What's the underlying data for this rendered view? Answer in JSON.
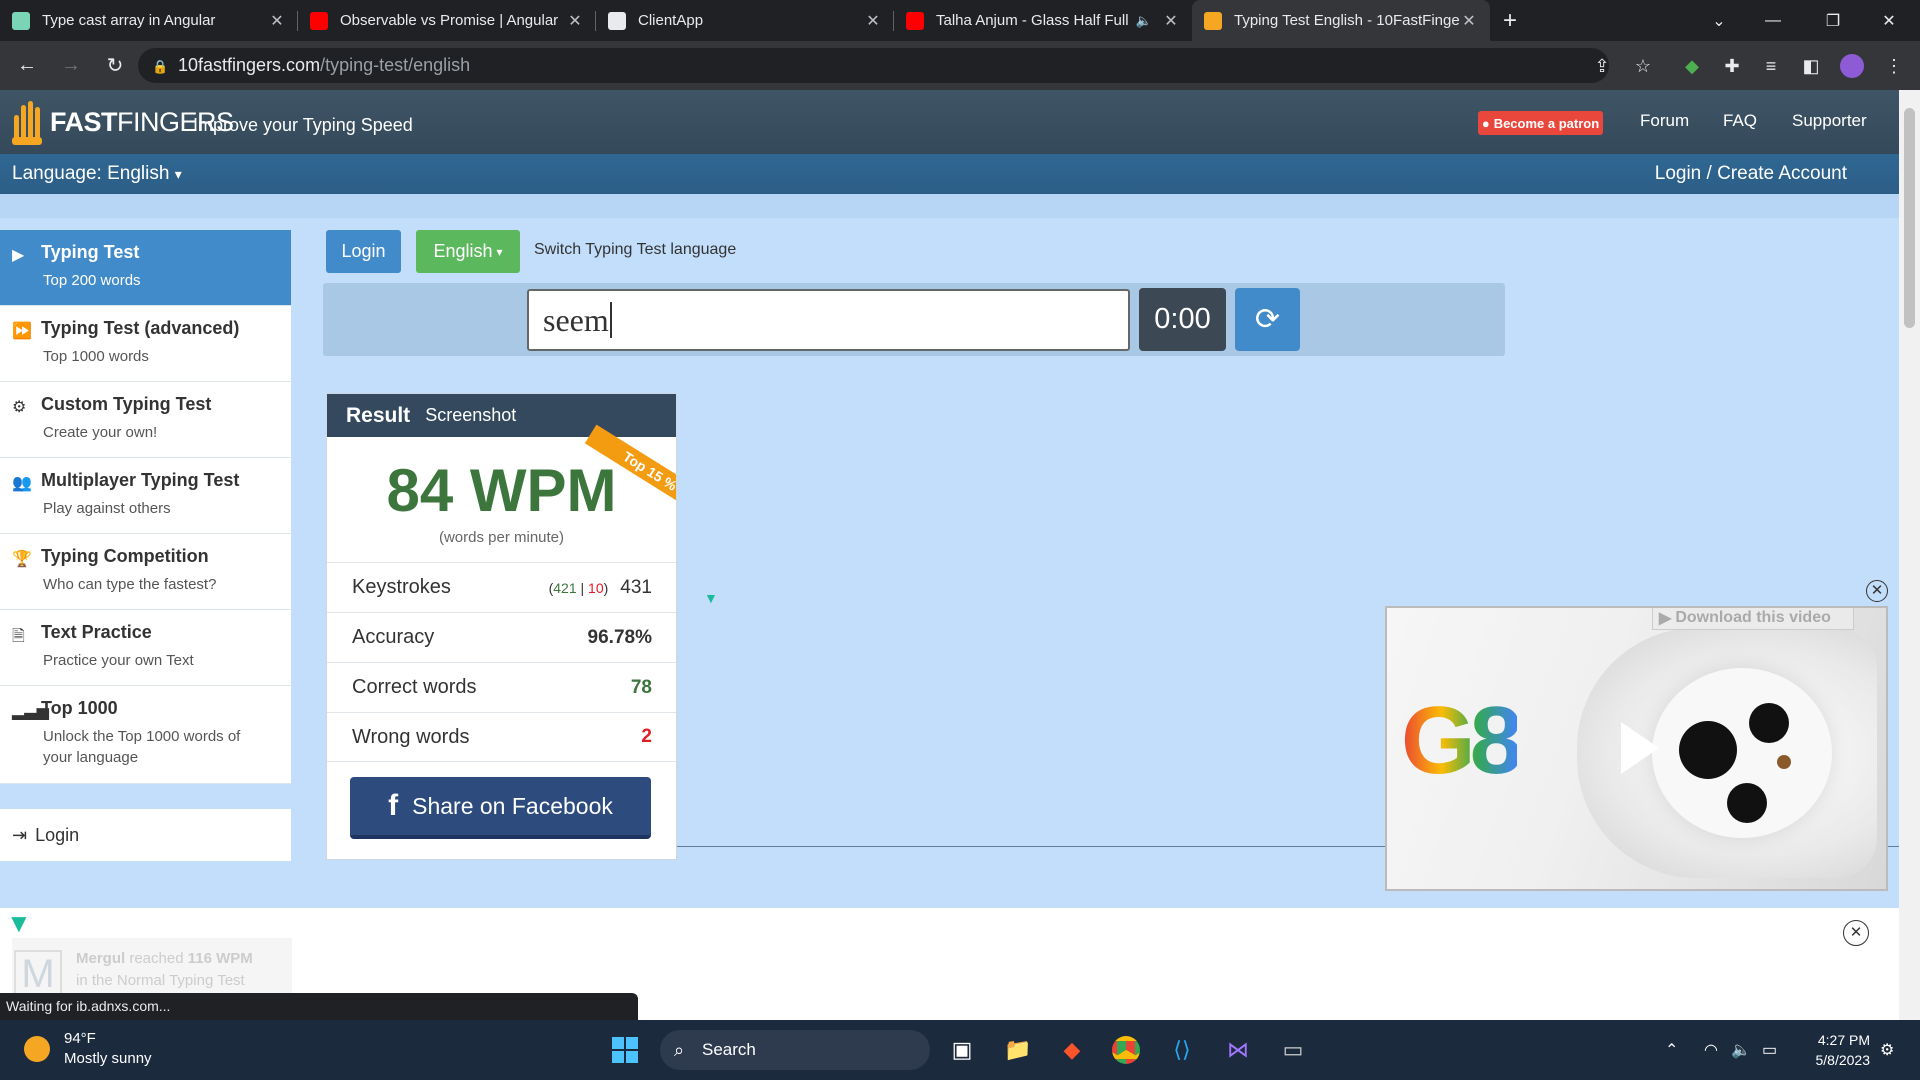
{
  "browser": {
    "tabs": [
      {
        "title": "Type cast array in Angular",
        "favicon_color": "#7ad4b6"
      },
      {
        "title": "Observable vs Promise | Angular",
        "favicon_color": "#ff0000"
      },
      {
        "title": "ClientApp",
        "favicon_color": "#e8eaed"
      },
      {
        "title": "Talha Anjum - Glass Half Full",
        "favicon_color": "#ff0000"
      },
      {
        "title": "Typing Test English - 10FastFinge",
        "favicon_color": "#f5a623"
      }
    ],
    "url_host": "10fastfingers.com",
    "url_path": "/typing-test/english",
    "status_text": "Waiting for ib.adnxs.com..."
  },
  "site": {
    "logo_fast": "FAST",
    "logo_fingers": "FINGERS",
    "tagline": "Improve your Typing Speed",
    "patron_label": "Become a patron",
    "nav": [
      "Forum",
      "FAQ",
      "Supporter"
    ],
    "language_label": "Language: English",
    "login_create": "Login / Create Account"
  },
  "sidebar": {
    "items": [
      {
        "title": "Typing Test",
        "sub": "Top 200 words",
        "icon": "play-icon"
      },
      {
        "title": "Typing Test (advanced)",
        "sub": "Top 1000 words",
        "icon": "fast-forward-icon"
      },
      {
        "title": "Custom Typing Test",
        "sub": "Create your own!",
        "icon": "gears-icon"
      },
      {
        "title": "Multiplayer Typing Test",
        "sub": "Play against others",
        "icon": "users-icon"
      },
      {
        "title": "Typing Competition",
        "sub": "Who can type the fastest?",
        "icon": "trophy-icon"
      },
      {
        "title": "Text Practice",
        "sub": "Practice your own Text",
        "icon": "document-icon"
      },
      {
        "title": "Top 1000",
        "sub": "Unlock the Top 1000 words of your language",
        "icon": "signal-icon"
      }
    ],
    "login": "Login"
  },
  "main": {
    "login_btn": "Login",
    "language_btn": "English",
    "switch_text": "Switch Typing Test language",
    "input_value": "seem",
    "timer": "0:00"
  },
  "result": {
    "heading": "Result",
    "screenshot": "Screenshot",
    "ribbon": "Top 15 %",
    "wpm": "84 WPM",
    "wpm_sub": "(words per minute)",
    "keystrokes_label": "Keystrokes",
    "keystrokes_correct": "421",
    "keystrokes_sep": "|",
    "keystrokes_wrong": "10",
    "keystrokes_total": "431",
    "accuracy_label": "Accuracy",
    "accuracy": "96.78%",
    "correct_label": "Correct words",
    "correct": "78",
    "wrong_label": "Wrong words",
    "wrong": "2",
    "share_fb": "Share on Facebook"
  },
  "feed": {
    "name": "Mergul",
    "action": "reached",
    "score": "116 WPM",
    "context": "in the Normal Typing Test",
    "avatar_letter": "M"
  },
  "ad": {
    "download": "Download this video",
    "brand_text": "G8"
  },
  "taskbar": {
    "temp": "94°F",
    "weather": "Mostly sunny",
    "search": "Search",
    "time": "4:27 PM",
    "date": "5/8/2023"
  },
  "colors": {
    "accent_blue": "#428bca",
    "green_btn": "#5cb85c",
    "wpm_green": "#3c763d",
    "error_red": "#e31b23",
    "ribbon_orange": "#f39c12"
  }
}
